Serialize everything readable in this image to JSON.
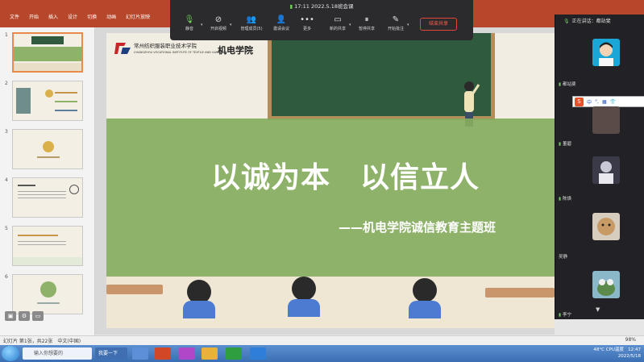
{
  "ribbon": {
    "tabs": [
      "文件",
      "开始",
      "插入",
      "设计",
      "切换",
      "动画",
      "幻灯片放映",
      "审阅",
      "视图",
      "帮助"
    ]
  },
  "thumbnails": [
    {
      "num": "1"
    },
    {
      "num": "2"
    },
    {
      "num": "3"
    },
    {
      "num": "4"
    },
    {
      "num": "5"
    },
    {
      "num": "6"
    }
  ],
  "slide": {
    "school_name": "常州纺织服装职业技术学院",
    "school_en": "CHANGZHOU VOCATIONAL INSTITUTE OF TEXTILE AND GARMENT",
    "college": "机电学院",
    "title": "以诚为本　以信立人",
    "subtitle": "——机电学院诚信教育主题班"
  },
  "status": {
    "left": "幻灯片 第1张，共22张　中文(中国)",
    "right": "98%"
  },
  "meeting": {
    "time": "17:11",
    "title": "2022.5.18班会课",
    "buttons": [
      "静音",
      "开启视频",
      "管理成员(5)",
      "邀请会议",
      "更多",
      "新的共享",
      "暂停共享",
      "开始批注"
    ],
    "end_share": "结束共享"
  },
  "panel": {
    "speaking_label": "正在讲话：都站斐",
    "participants": [
      {
        "name": "都站斐"
      },
      {
        "name": "董碧"
      },
      {
        "name": "陈焕"
      },
      {
        "name": "吴静"
      },
      {
        "name": "李宁"
      }
    ],
    "ime": "中"
  },
  "taskbar": {
    "search": "输入你想要的",
    "app_label": "我要一下",
    "temp": "48°C",
    "cpu": "CPU温度",
    "time": "12:47",
    "date": "2022/5/18"
  },
  "colors": {
    "ribbon": "#b7472a",
    "band": "#86ac5e",
    "end_share": "#e0483a"
  }
}
